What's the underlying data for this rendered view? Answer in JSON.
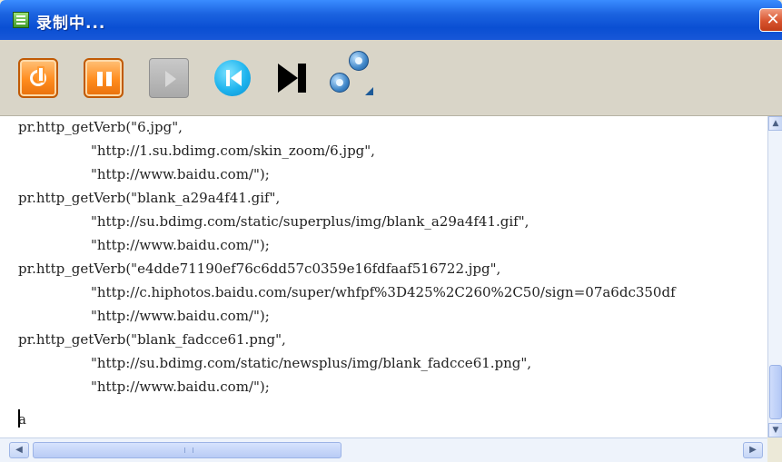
{
  "window": {
    "title": "录制中...",
    "close_glyph": "✕"
  },
  "toolbar": {
    "buttons": [
      {
        "name": "power-icon",
        "enabled": true
      },
      {
        "name": "pause-icon",
        "enabled": true
      },
      {
        "name": "play-icon",
        "enabled": false
      },
      {
        "name": "skip-back-icon",
        "enabled": true
      },
      {
        "name": "skip-forward-icon",
        "enabled": true
      },
      {
        "name": "options-icon",
        "enabled": true
      }
    ]
  },
  "editor": {
    "lines": [
      "pr.http_getVerb(\"6.jpg\",",
      "\"http://1.su.bdimg.com/skin_zoom/6.jpg\",",
      "\"http://www.baidu.com/\");",
      "pr.http_getVerb(\"blank_a29a4f41.gif\",",
      "\"http://su.bdimg.com/static/superplus/img/blank_a29a4f41.gif\",",
      "\"http://www.baidu.com/\");",
      "pr.http_getVerb(\"e4dde71190ef76c6dd57c0359e16fdfaaf516722.jpg\",",
      "\"http://c.hiphotos.baidu.com/super/whfpf%3D425%2C260%2C50/sign=07a6dc350df",
      "\"http://www.baidu.com/\");",
      "pr.http_getVerb(\"blank_fadcce61.png\",",
      "\"http://su.bdimg.com/static/newsplus/img/blank_fadcce61.png\",",
      "\"http://www.baidu.com/\");",
      "",
      "a"
    ]
  },
  "colors": {
    "titlebar": "#0a4fd3",
    "toolbar": "#d9d5c8",
    "accent_orange": "#ff8c1e",
    "accent_blue": "#1fb4ee"
  }
}
